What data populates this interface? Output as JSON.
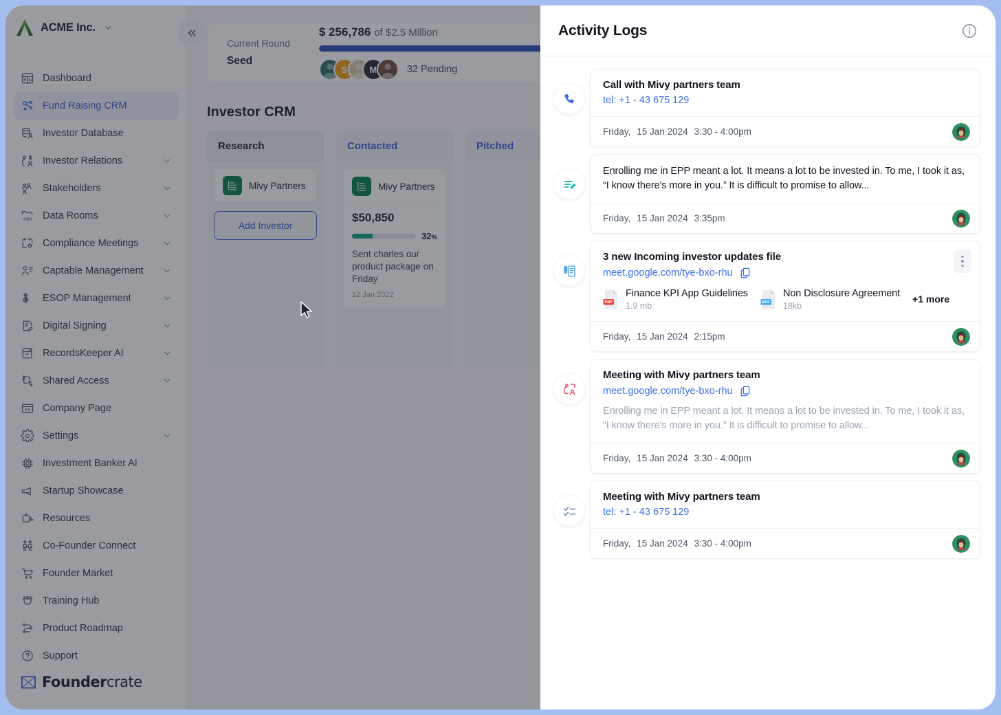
{
  "sidebar": {
    "brand": {
      "name": "ACME Inc.",
      "logo_icon": "acme-a-logo",
      "caret_icon": "chevron-down-icon"
    },
    "collapse_button": {
      "icon": "double-chevron-left-icon"
    },
    "items": [
      {
        "label": "Dashboard",
        "icon": "dashboard-icon",
        "active": false,
        "expandable": false
      },
      {
        "label": "Fund Raising CRM",
        "icon": "fundraising-crm-icon",
        "active": true,
        "expandable": false
      },
      {
        "label": "Investor Database",
        "icon": "investor-database-icon",
        "active": false,
        "expandable": false
      },
      {
        "label": "Investor Relations",
        "icon": "investor-relations-icon",
        "active": false,
        "expandable": true
      },
      {
        "label": "Stakeholders",
        "icon": "stakeholders-icon",
        "active": false,
        "expandable": true
      },
      {
        "label": "Data Rooms",
        "icon": "data-rooms-icon",
        "active": false,
        "expandable": true
      },
      {
        "label": "Compliance Meetings",
        "icon": "compliance-meetings-icon",
        "active": false,
        "expandable": true
      },
      {
        "label": "Captable Management",
        "icon": "captable-management-icon",
        "active": false,
        "expandable": true
      },
      {
        "label": "ESOP Management",
        "icon": "esop-management-icon",
        "active": false,
        "expandable": true
      },
      {
        "label": "Digital Signing",
        "icon": "digital-signing-icon",
        "active": false,
        "expandable": true
      },
      {
        "label": "RecordsKeeper AI",
        "icon": "recordskeeper-ai-icon",
        "active": false,
        "expandable": true
      },
      {
        "label": "Shared Access",
        "icon": "shared-access-icon",
        "active": false,
        "expandable": true
      },
      {
        "label": "Company Page",
        "icon": "company-page-icon",
        "active": false,
        "expandable": false
      },
      {
        "label": "Settings",
        "icon": "gear-icon",
        "active": false,
        "expandable": true
      },
      {
        "label": "Investment Banker AI",
        "icon": "investment-banker-ai-icon",
        "active": false,
        "expandable": false
      },
      {
        "label": "Startup Showcase",
        "icon": "megaphone-icon",
        "active": false,
        "expandable": false
      },
      {
        "label": "Resources",
        "icon": "briefcase-icon",
        "active": false,
        "expandable": false
      },
      {
        "label": "Co-Founder Connect",
        "icon": "co-founder-connect-icon",
        "active": false,
        "expandable": false
      },
      {
        "label": "Founder Market",
        "icon": "cart-icon",
        "active": false,
        "expandable": false
      },
      {
        "label": "Training Hub",
        "icon": "graduation-cap-icon",
        "active": false,
        "expandable": false
      },
      {
        "label": "Product Roadmap",
        "icon": "roadmap-icon",
        "active": false,
        "expandable": false
      },
      {
        "label": "Support",
        "icon": "question-circle-icon",
        "active": false,
        "expandable": false
      }
    ],
    "footer_brand": {
      "bold": "Founder",
      "light": "crate",
      "mark_icon": "foundercrate-logo"
    }
  },
  "main": {
    "round_card": {
      "round_label": "Current Round",
      "round_value": "Seed",
      "amount": "$ 256,786",
      "amount_of": "of $2.5 Million",
      "progress_percent": 62,
      "bar_color": "#2c50b5",
      "avatars": [
        {
          "initial": "",
          "color": "#2f6f62"
        },
        {
          "initial": "S",
          "color": "#e9a01b"
        },
        {
          "initial": "",
          "color": "#d9c6a8"
        },
        {
          "initial": "M",
          "color": "#2b2f38"
        },
        {
          "initial": "",
          "color": "#6f5141"
        }
      ],
      "pending": "32 Pending"
    },
    "section_title": "Investor CRM",
    "columns": [
      {
        "title": "Research",
        "accent": "#1c2434",
        "chip": {
          "name": "Mivy Partners",
          "logo_icon": "mivy-partners-logo"
        },
        "add_label": "Add Investor"
      },
      {
        "title": "Contacted",
        "accent": "#3b63d8",
        "deal": {
          "name": "Mivy Partners",
          "logo_icon": "mivy-partners-logo",
          "amount": "$50,850",
          "percent": 32,
          "percent_label": "32",
          "percent_unit": "%",
          "note": "Sent charles our product package on Friday",
          "date": "12 Jan 2022"
        }
      },
      {
        "title": "Pitched",
        "accent": "#3b63d8"
      }
    ]
  },
  "panel": {
    "title": "Activity Logs",
    "info_icon": "info-circle-icon",
    "logs": [
      {
        "icon": "phone-call-icon",
        "icon_color": "#3b6ff0",
        "title": "Call with Mivy partners team",
        "link": "tel: +1 - 43 675 129",
        "link_type": "tel",
        "has_copy": false,
        "quote": null,
        "files": [],
        "more_files": null,
        "has_kebab": false,
        "day": "Friday,",
        "date": "15 Jan 2024",
        "time": "3:30 - 4:00pm",
        "avatar_icon": "user-avatar"
      },
      {
        "icon": "note-edit-icon",
        "icon_color": "#18b8a5",
        "title": null,
        "link": null,
        "has_copy": false,
        "quote": "Enrolling me in EPP meant a lot. It means a lot to be invested in. To me, I took it as, “I know there's more in you.” It is difficult to promise to allow...",
        "quote_muted": false,
        "files": [],
        "more_files": null,
        "has_kebab": false,
        "day": "Friday,",
        "date": "15 Jan 2024",
        "time": "3:35pm",
        "avatar_icon": "user-avatar"
      },
      {
        "icon": "attachment-document-icon",
        "icon_color": "#4da3f0",
        "title": "3 new Incoming investor updates file",
        "link": "meet.google.com/tye-bxo-rhu",
        "link_type": "url",
        "has_copy": true,
        "copy_icon": "copy-icon",
        "quote": null,
        "files": [
          {
            "name": "Finance KPI App Guidelines",
            "size": "1.9 mb",
            "type": "PDF",
            "badge_color": "#f2453d"
          },
          {
            "name": "Non Disclosure Agreement",
            "size": "18kb",
            "type": "DOC",
            "badge_color": "#3fa9f5"
          }
        ],
        "more_files": "+1 more",
        "has_kebab": true,
        "kebab_icon": "kebab-menu-icon",
        "day": "Friday,",
        "date": "15 Jan 2024",
        "time": "2:15pm",
        "avatar_icon": "user-avatar"
      },
      {
        "icon": "meeting-people-icon",
        "icon_color": "#f0506e",
        "title": "Meeting with Mivy partners team",
        "link": "meet.google.com/tye-bxo-rhu",
        "link_type": "url",
        "has_copy": true,
        "copy_icon": "copy-icon",
        "quote": "Enrolling me in EPP meant a lot. It means a lot to be invested in. To me, I took it as, “I know there's more in you.” It is difficult to promise to allow...",
        "quote_muted": true,
        "files": [],
        "more_files": null,
        "has_kebab": false,
        "day": "Friday,",
        "date": "15 Jan 2024",
        "time": "3:30 - 4:00pm",
        "avatar_icon": "user-avatar"
      },
      {
        "icon": "checklist-icon",
        "icon_color": "#6b7fa8",
        "title": "Meeting with Mivy partners team",
        "link": "tel: +1 - 43 675 129",
        "link_type": "tel",
        "has_copy": false,
        "quote": null,
        "files": [],
        "more_files": null,
        "has_kebab": false,
        "day": "Friday,",
        "date": "15 Jan 2024",
        "time": "3:30 - 4:00pm",
        "avatar_icon": "user-avatar"
      }
    ]
  },
  "colors": {
    "accent_blue": "#3b63d8",
    "link_blue": "#3b6ff0",
    "green": "#0a8055",
    "teal": "#0fa37f",
    "page_bg": "#a4bdf0"
  }
}
